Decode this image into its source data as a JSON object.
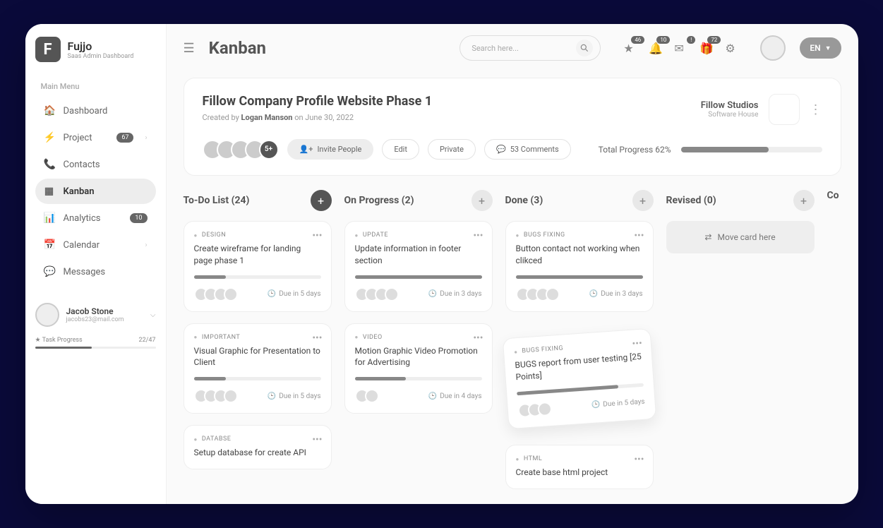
{
  "brand": {
    "name": "Fujjo",
    "tagline": "Saas Admin Dashboard"
  },
  "menu_label": "Main Menu",
  "nav": [
    {
      "icon": "home",
      "label": "Dashboard"
    },
    {
      "icon": "bolt",
      "label": "Project",
      "badge": "67",
      "chev": true
    },
    {
      "icon": "phone",
      "label": "Contacts"
    },
    {
      "icon": "grid",
      "label": "Kanban",
      "active": true
    },
    {
      "icon": "bars",
      "label": "Analytics",
      "badge": "10"
    },
    {
      "icon": "calendar",
      "label": "Calendar",
      "chev": true
    },
    {
      "icon": "message",
      "label": "Messages"
    }
  ],
  "user": {
    "name": "Jacob Stone",
    "email": "jacobs23@mail.com"
  },
  "task_progress": {
    "label": "Task Progress",
    "count": "22/47"
  },
  "page_title": "Kanban",
  "search_placeholder": "Search here...",
  "top_badges": {
    "star": "46",
    "bell": "10",
    "envelope": "!",
    "gift": "72"
  },
  "lang": "EN",
  "project": {
    "title": "Fillow Company Profile Website Phase 1",
    "created_prefix": "Created by ",
    "author": "Logan Manson",
    "created_suffix": " on June 30, 2022",
    "studio": "Fillow Studios",
    "studio_sub": "Software House",
    "avatar_more": "5+",
    "invite": "Invite People",
    "edit": "Edit",
    "private": "Private",
    "comments": "53 Comments",
    "progress_label": "Total Progress 62%"
  },
  "columns": [
    {
      "title": "To-Do List (24)",
      "dark": true
    },
    {
      "title": "On Progress (2)"
    },
    {
      "title": "Done (3)"
    },
    {
      "title": "Revised (0)",
      "empty": true
    },
    {
      "title": "Co"
    }
  ],
  "cards": {
    "todo": [
      {
        "tag": "Design",
        "title": "Create wireframe for landing page phase 1",
        "due": "Due in 5 days",
        "avs": 4,
        "prog": 25
      },
      {
        "tag": "Important",
        "title": "Visual Graphic for Presentation to Client",
        "due": "Due in 5 days",
        "avs": 4,
        "prog": 25
      },
      {
        "tag": "Databse",
        "title": "Setup database for create API",
        "due": "",
        "avs": 0,
        "prog": 0
      }
    ],
    "progress": [
      {
        "tag": "UPDATE",
        "title": "Update information in footer section",
        "due": "Due in 3 days",
        "avs": 4,
        "prog": 100
      },
      {
        "tag": "Video",
        "title": "Motion Graphic Video Promotion for Advertising",
        "due": "Due in 4  days",
        "avs": 2,
        "prog": 40
      }
    ],
    "done": [
      {
        "tag": "BUGS FIXING",
        "title": "Button contact not working when clikced",
        "due": "Due in 3 days",
        "avs": 4,
        "prog": 100
      },
      {
        "tag": "BUGS FIXING",
        "title": "BUGS report from user testing [25 Points]",
        "due": "Due in 5 days",
        "avs": 3,
        "prog": 80,
        "tilted": true
      },
      {
        "tag": "HTML",
        "title": "Create base html project",
        "due": "",
        "avs": 0,
        "prog": 0
      }
    ]
  },
  "move_label": "Move card here"
}
